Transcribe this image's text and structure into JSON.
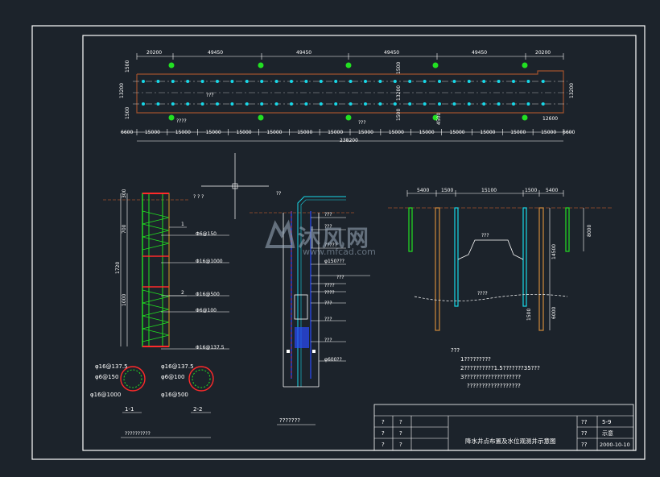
{
  "colors": {
    "background": "#1c232b",
    "frame": "#ffffff",
    "cyan": "#18d8e8",
    "green": "#22e022",
    "red": "#ff2a2a",
    "brown": "#a0522d",
    "orange": "#d08a3a",
    "blue": "#2a4cff"
  },
  "plan": {
    "top_dims": [
      "20200",
      "49450",
      "49450",
      "49450",
      "49450",
      "20200"
    ],
    "bottom_dims": [
      "15000",
      "15000",
      "15000",
      "15000",
      "15000",
      "15000",
      "15000",
      "15000",
      "15000",
      "15000",
      "15000",
      "15000",
      "15000",
      "15000"
    ],
    "left_dims": [
      "13200",
      "1500",
      "1500"
    ],
    "mid_dims": [
      "1500",
      "13200",
      "1500"
    ],
    "right_dim": "13200",
    "edge_left": "6600",
    "edge_right": "6600",
    "total": "238200",
    "inner_label": "???",
    "note_left": "????",
    "note_mid": "???",
    "note_right_dim": "12600",
    "small_mark": "4500"
  },
  "column": {
    "top_dim": "300",
    "dims": [
      "700",
      "1720",
      "1000"
    ],
    "section_marks": [
      "1",
      "1",
      "2",
      "2"
    ],
    "annotations": [
      "Φ6@150",
      "Φ16@1000",
      "Φ16@500",
      "Φ6@100",
      "Φ16@137.5"
    ],
    "ground_label": "? ? ?"
  },
  "sections": {
    "s1_labels": [
      "φ16@137.5",
      "φ6@150",
      "φ16@1000"
    ],
    "s2_labels": [
      "φ16@137.5",
      "φ6@100",
      "φ16@500"
    ],
    "s1_title": "1-1",
    "s2_title": "2-2",
    "caption": "??????????"
  },
  "well": {
    "top_label": "??",
    "labels": [
      "???",
      "???",
      "?????",
      "φ150???",
      "???",
      "????",
      "????",
      "???",
      "???",
      "???",
      "φ600??"
    ],
    "caption": "???????"
  },
  "profile": {
    "dims": [
      "5400",
      "1500",
      "15100",
      "1500",
      "5400"
    ],
    "vert_dims": [
      "8000",
      "14500",
      "6000",
      "1500"
    ],
    "inner_label": "???",
    "lower_label": "????"
  },
  "notes": {
    "title": "???",
    "lines": [
      "1?????????",
      "2??????????1.5???????35???",
      "3???????????????????",
      "??????????????????"
    ]
  },
  "titleblock": {
    "left_cells": [
      "?",
      "?",
      "?",
      "?",
      "?",
      "?"
    ],
    "title": "降水井点布置及水位观测井示意图",
    "right_labels": [
      "??",
      "??",
      "??"
    ],
    "drawing_no": "5-9",
    "scale": "示意",
    "date": "2000-10-10"
  },
  "watermark": {
    "text": "沐风网",
    "url": "www.mfcad.com"
  }
}
